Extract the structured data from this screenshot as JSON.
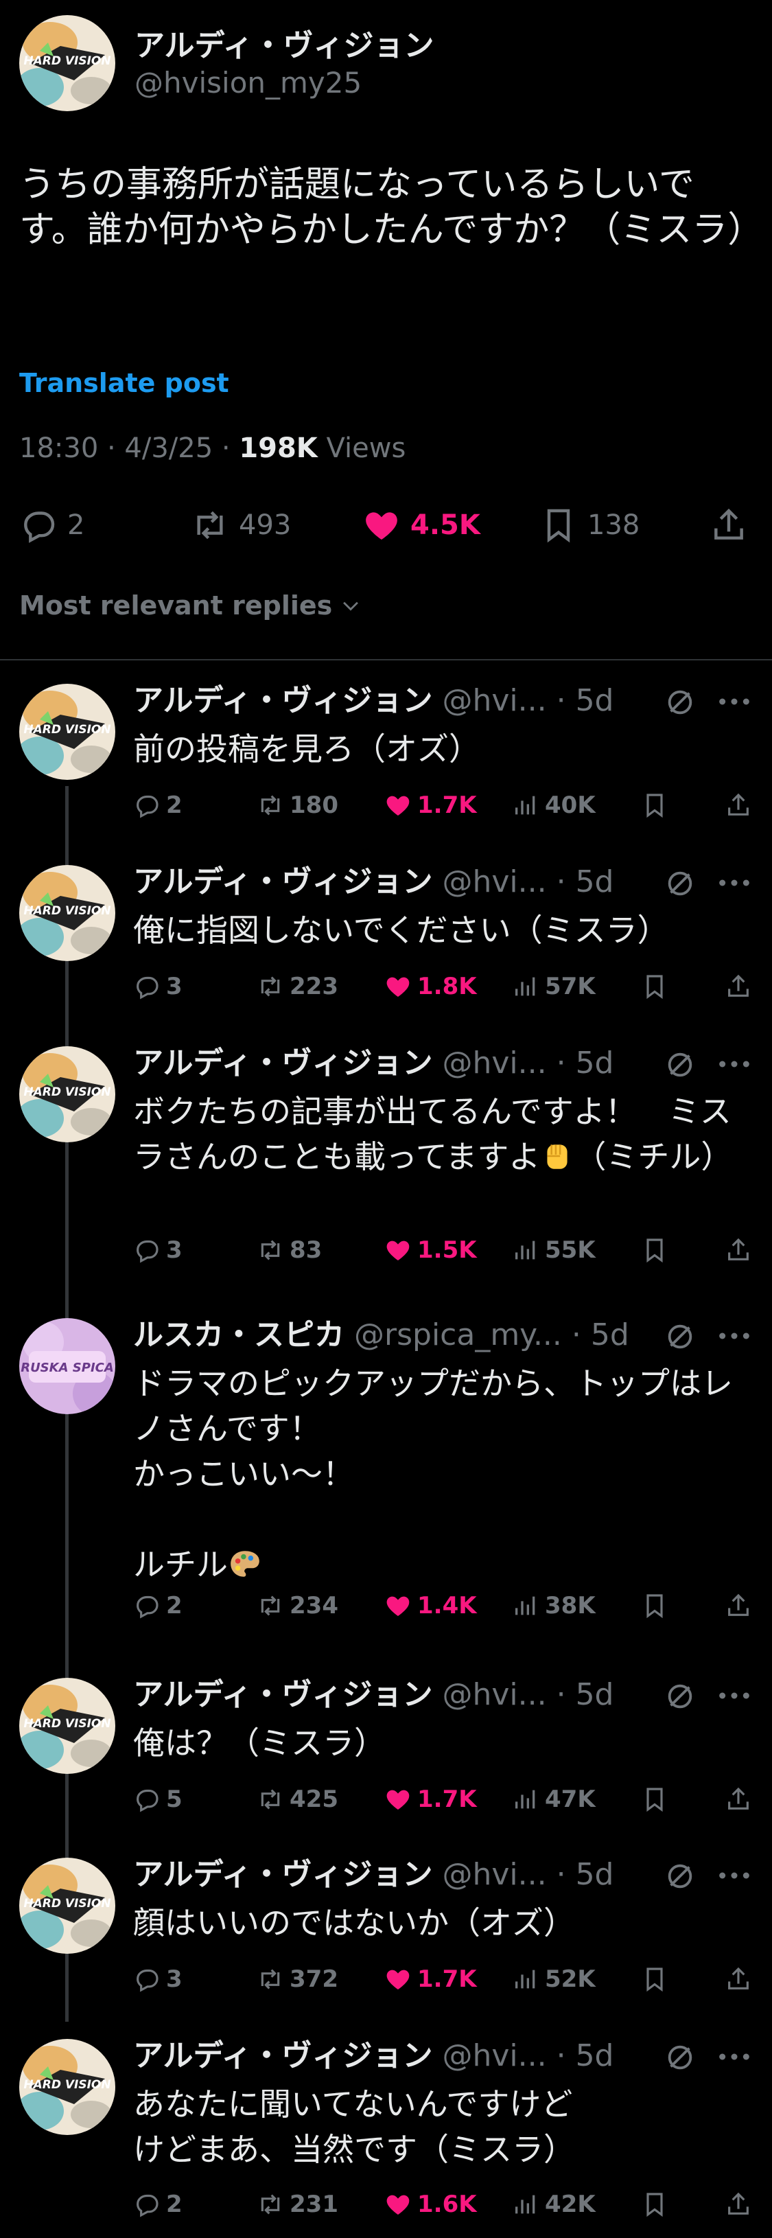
{
  "post": {
    "name": "アルディ・ヴィジョン",
    "handle": "@hvision_my25",
    "text": "うちの事務所が話題になっているらしいです。誰か何かやらかしたんですか？（ミスラ）",
    "translate_label": "Translate post",
    "time": "18:30 · 4/3/25 · ",
    "views_count": "198K",
    "views_label": " Views",
    "replies": "2",
    "reposts": "493",
    "likes": "4.5K",
    "bookmarks": "138"
  },
  "sort_label": "Most relevant replies",
  "avatar_logo_text": "HARD VISION",
  "avatar_logo_text_2": "RUSKA SPICA",
  "colors": {
    "like": "#f91880",
    "link": "#1d9bf0",
    "muted": "#71767b",
    "text": "#e7e9ea"
  },
  "replies": [
    {
      "name": "アルディ・ヴィジョン",
      "handle": "@hvi...",
      "time": "5d",
      "text": "前の投稿を見ろ（オズ）",
      "replies": "2",
      "reposts": "180",
      "likes": "1.7K",
      "views": "40K"
    },
    {
      "name": "アルディ・ヴィジョン",
      "handle": "@hvi...",
      "time": "5d",
      "text": "俺に指図しないでください（ミスラ）",
      "replies": "3",
      "reposts": "223",
      "likes": "1.8K",
      "views": "57K"
    },
    {
      "name": "アルディ・ヴィジョン",
      "handle": "@hvi...",
      "time": "5d",
      "text": "ボクたちの記事が出てるんですよ！　ミスラさんのことも載ってますよ",
      "text_after": "（ミチル）",
      "emoji": "raised-fist-emoji",
      "replies": "3",
      "reposts": "83",
      "likes": "1.5K",
      "views": "55K"
    },
    {
      "name": "ルスカ・スピカ",
      "handle": "@rspica_my...",
      "time": "5d",
      "text": "ドラマのピックアップだから、トップはレノさんです！\nかっこいい～！\n\nルチル",
      "emoji": "artist-palette-emoji",
      "replies": "2",
      "reposts": "234",
      "likes": "1.4K",
      "views": "38K"
    },
    {
      "name": "アルディ・ヴィジョン",
      "handle": "@hvi...",
      "time": "5d",
      "text": "俺は？（ミスラ）",
      "replies": "5",
      "reposts": "425",
      "likes": "1.7K",
      "views": "47K"
    },
    {
      "name": "アルディ・ヴィジョン",
      "handle": "@hvi...",
      "time": "5d",
      "text": "顔はいいのではないか（オズ）",
      "replies": "3",
      "reposts": "372",
      "likes": "1.7K",
      "views": "52K"
    },
    {
      "name": "アルディ・ヴィジョン",
      "handle": "@hvi...",
      "time": "5d",
      "text": "あなたに聞いてないんですけど\nけどまあ、当然です（ミスラ）",
      "replies": "2",
      "reposts": "231",
      "likes": "1.6K",
      "views": "42K"
    }
  ]
}
